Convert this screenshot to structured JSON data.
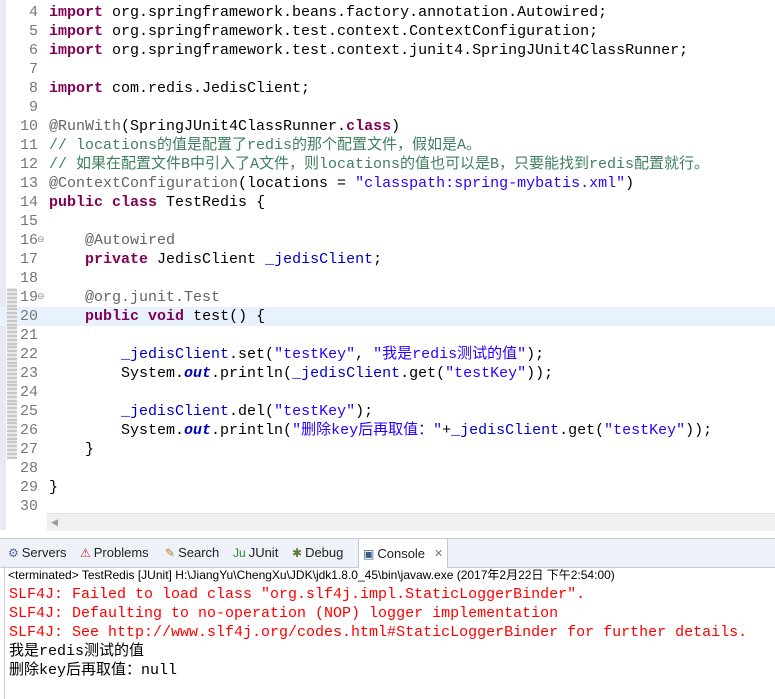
{
  "editor": {
    "current_line": 20,
    "lines": [
      {
        "n": "4",
        "segs": [
          [
            "import",
            "kw"
          ],
          [
            " org.springframework.beans.factory.annotation.Autowired;",
            ""
          ]
        ]
      },
      {
        "n": "5",
        "segs": [
          [
            "import",
            "kw"
          ],
          [
            " org.springframework.test.context.ContextConfiguration;",
            ""
          ]
        ]
      },
      {
        "n": "6",
        "segs": [
          [
            "import",
            "kw"
          ],
          [
            " org.springframework.test.context.junit4.SpringJUnit4ClassRunner;",
            ""
          ]
        ]
      },
      {
        "n": "7",
        "segs": []
      },
      {
        "n": "8",
        "segs": [
          [
            "import",
            "kw"
          ],
          [
            " com.redis.JedisClient;",
            ""
          ]
        ]
      },
      {
        "n": "9",
        "segs": []
      },
      {
        "n": "10",
        "segs": [
          [
            "@RunWith",
            "an"
          ],
          [
            "(SpringJUnit4ClassRunner.",
            ""
          ],
          [
            "class",
            "kw"
          ],
          [
            ")",
            ""
          ]
        ]
      },
      {
        "n": "11",
        "segs": [
          [
            "// locations的值是配置了redis的那个配置文件，假如是A。",
            "cm"
          ]
        ]
      },
      {
        "n": "12",
        "segs": [
          [
            "// 如果在配置文件B中引入了A文件，则locations的值也可以是B，只要能找到redis配置就行。",
            "cm"
          ]
        ]
      },
      {
        "n": "13",
        "segs": [
          [
            "@ContextConfiguration",
            "an"
          ],
          [
            "(locations = ",
            ""
          ],
          [
            "\"classpath:spring-mybatis.xml\"",
            "st"
          ],
          [
            ")",
            ""
          ]
        ]
      },
      {
        "n": "14",
        "segs": [
          [
            "public",
            "kw"
          ],
          [
            " ",
            ""
          ],
          [
            "class",
            "kw"
          ],
          [
            " TestRedis {",
            ""
          ]
        ]
      },
      {
        "n": "15",
        "segs": []
      },
      {
        "n": "16",
        "fold": true,
        "segs": [
          [
            "    ",
            ""
          ],
          [
            "@Autowired",
            "an"
          ]
        ]
      },
      {
        "n": "17",
        "segs": [
          [
            "    ",
            ""
          ],
          [
            "private",
            "kw"
          ],
          [
            " JedisClient ",
            ""
          ],
          [
            "_jedisClient",
            "fd"
          ],
          [
            ";",
            ""
          ]
        ]
      },
      {
        "n": "18",
        "segs": []
      },
      {
        "n": "19",
        "fold": true,
        "mark": true,
        "segs": [
          [
            "    ",
            ""
          ],
          [
            "@org.junit.Test",
            "an"
          ]
        ]
      },
      {
        "n": "20",
        "mark": true,
        "segs": [
          [
            "    ",
            ""
          ],
          [
            "public",
            "kw"
          ],
          [
            " ",
            ""
          ],
          [
            "void",
            "kw"
          ],
          [
            " test() {",
            ""
          ]
        ]
      },
      {
        "n": "21",
        "mark": true,
        "segs": []
      },
      {
        "n": "22",
        "mark": true,
        "segs": [
          [
            "        ",
            ""
          ],
          [
            "_jedisClient",
            "fd"
          ],
          [
            ".set(",
            ""
          ],
          [
            "\"testKey\"",
            "st"
          ],
          [
            ", ",
            ""
          ],
          [
            "\"我是redis测试的值\"",
            "st"
          ],
          [
            ");",
            ""
          ]
        ]
      },
      {
        "n": "23",
        "mark": true,
        "segs": [
          [
            "        System.",
            ""
          ],
          [
            "out",
            "sf"
          ],
          [
            ".println(",
            ""
          ],
          [
            "_jedisClient",
            "fd"
          ],
          [
            ".get(",
            ""
          ],
          [
            "\"testKey\"",
            "st"
          ],
          [
            "));",
            ""
          ]
        ]
      },
      {
        "n": "24",
        "mark": true,
        "segs": []
      },
      {
        "n": "25",
        "mark": true,
        "segs": [
          [
            "        ",
            ""
          ],
          [
            "_jedisClient",
            "fd"
          ],
          [
            ".del(",
            ""
          ],
          [
            "\"testKey\"",
            "st"
          ],
          [
            ");",
            ""
          ]
        ]
      },
      {
        "n": "26",
        "mark": true,
        "segs": [
          [
            "        System.",
            ""
          ],
          [
            "out",
            "sf"
          ],
          [
            ".println(",
            ""
          ],
          [
            "\"删除key后再取值：\"",
            "st"
          ],
          [
            "+",
            ""
          ],
          [
            "_jedisClient",
            "fd"
          ],
          [
            ".get(",
            ""
          ],
          [
            "\"testKey\"",
            "st"
          ],
          [
            "));",
            ""
          ]
        ]
      },
      {
        "n": "27",
        "mark": true,
        "segs": [
          [
            "    }",
            ""
          ]
        ]
      },
      {
        "n": "28",
        "segs": []
      },
      {
        "n": "29",
        "segs": [
          [
            "}",
            ""
          ]
        ]
      },
      {
        "n": "30",
        "segs": []
      }
    ]
  },
  "tabs": [
    {
      "label": "Servers",
      "icon": "servers-icon",
      "glyph": "⚙"
    },
    {
      "label": "Problems",
      "icon": "problems-icon",
      "glyph": "⚠"
    },
    {
      "label": "Search",
      "icon": "search-icon",
      "glyph": "✎"
    },
    {
      "label": "JUnit",
      "icon": "junit-icon",
      "glyph": "Ju"
    },
    {
      "label": "Debug",
      "icon": "debug-icon",
      "glyph": "✱"
    },
    {
      "label": "Console",
      "icon": "console-icon",
      "glyph": "▣",
      "active": true,
      "close": "✕"
    }
  ],
  "console": {
    "header": "<terminated> TestRedis [JUnit] H:\\JiangYu\\ChengXu\\JDK\\jdk1.8.0_45\\bin\\javaw.exe (2017年2月22日 下午2:54:00)",
    "lines": [
      {
        "text": "SLF4J: Failed to load class \"org.slf4j.impl.StaticLoggerBinder\".",
        "type": "err"
      },
      {
        "text": "SLF4J: Defaulting to no-operation (NOP) logger implementation",
        "type": "err"
      },
      {
        "text": "SLF4J: See http://www.slf4j.org/codes.html#StaticLoggerBinder for further details.",
        "type": "err"
      },
      {
        "text": "我是redis测试的值",
        "type": "norm"
      },
      {
        "text": "删除key后再取值：null",
        "type": "norm"
      }
    ]
  },
  "colors": {
    "keyword": "#7f0055",
    "string": "#2a00ff",
    "comment": "#3f7f5f",
    "field": "#0000c0",
    "error": "#ff0000"
  }
}
